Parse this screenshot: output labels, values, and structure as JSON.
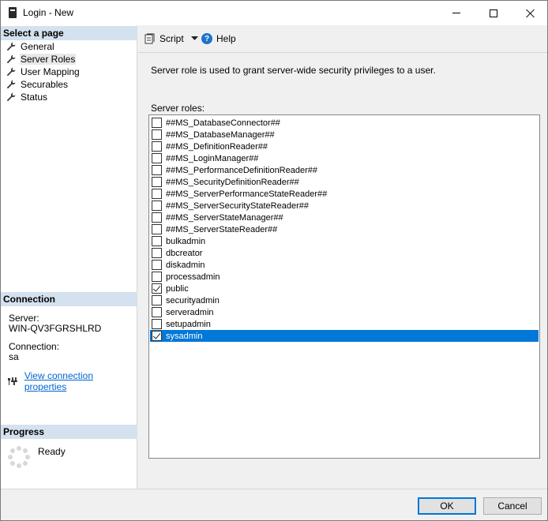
{
  "window": {
    "title": "Login - New"
  },
  "left_panel": {
    "select_page_header": "Select a page",
    "pages": [
      {
        "label": "General",
        "selected": false
      },
      {
        "label": "Server Roles",
        "selected": true
      },
      {
        "label": "User Mapping",
        "selected": false
      },
      {
        "label": "Securables",
        "selected": false
      },
      {
        "label": "Status",
        "selected": false
      }
    ],
    "connection_header": "Connection",
    "server_label": "Server:",
    "server_value": "WIN-QV3FGRSHLRD",
    "connection_label": "Connection:",
    "connection_value": "sa",
    "view_connection_link": "View connection properties",
    "progress_header": "Progress",
    "progress_status": "Ready"
  },
  "toolbar": {
    "script_label": "Script",
    "help_label": "Help"
  },
  "main": {
    "description": "Server role is used to grant server-wide security privileges to a user.",
    "roles_label": "Server roles:",
    "roles": [
      {
        "name": "##MS_DatabaseConnector##",
        "checked": false,
        "selected": false
      },
      {
        "name": "##MS_DatabaseManager##",
        "checked": false,
        "selected": false
      },
      {
        "name": "##MS_DefinitionReader##",
        "checked": false,
        "selected": false
      },
      {
        "name": "##MS_LoginManager##",
        "checked": false,
        "selected": false
      },
      {
        "name": "##MS_PerformanceDefinitionReader##",
        "checked": false,
        "selected": false
      },
      {
        "name": "##MS_SecurityDefinitionReader##",
        "checked": false,
        "selected": false
      },
      {
        "name": "##MS_ServerPerformanceStateReader##",
        "checked": false,
        "selected": false
      },
      {
        "name": "##MS_ServerSecurityStateReader##",
        "checked": false,
        "selected": false
      },
      {
        "name": "##MS_ServerStateManager##",
        "checked": false,
        "selected": false
      },
      {
        "name": "##MS_ServerStateReader##",
        "checked": false,
        "selected": false
      },
      {
        "name": "bulkadmin",
        "checked": false,
        "selected": false
      },
      {
        "name": "dbcreator",
        "checked": false,
        "selected": false
      },
      {
        "name": "diskadmin",
        "checked": false,
        "selected": false
      },
      {
        "name": "processadmin",
        "checked": false,
        "selected": false
      },
      {
        "name": "public",
        "checked": true,
        "selected": false
      },
      {
        "name": "securityadmin",
        "checked": false,
        "selected": false
      },
      {
        "name": "serveradmin",
        "checked": false,
        "selected": false
      },
      {
        "name": "setupadmin",
        "checked": false,
        "selected": false
      },
      {
        "name": "sysadmin",
        "checked": true,
        "selected": true
      }
    ]
  },
  "footer": {
    "ok_label": "OK",
    "cancel_label": "Cancel"
  },
  "colors": {
    "section_header_bg": "#d4e1ee",
    "selection_bg": "#0078d7",
    "link": "#0066cc"
  }
}
